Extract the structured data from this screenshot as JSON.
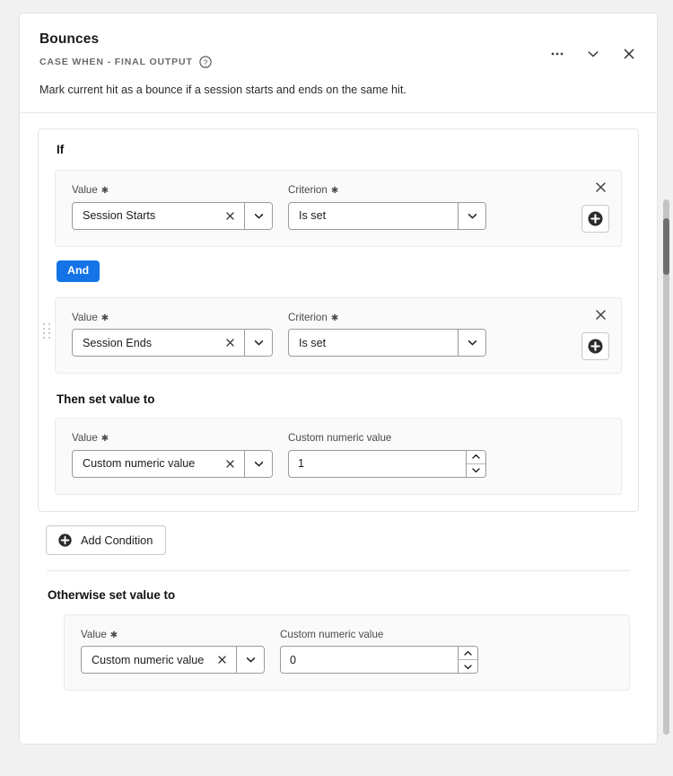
{
  "card": {
    "title": "Bounces",
    "subtitle": "CASE WHEN - FINAL OUTPUT",
    "help_icon": "help-circle-icon",
    "description": "Mark current hit as a bounce if a session starts and ends on the same hit.",
    "actions": {
      "more_icon": "ellipsis-icon",
      "collapse_icon": "chevron-down-icon",
      "close_icon": "close-icon"
    }
  },
  "if_group": {
    "heading": "If",
    "conditions": [
      {
        "value_label": "Value",
        "value_required": "✱",
        "value": "Session Starts",
        "clear_icon": "close-icon",
        "dropdown_icon": "chevron-down-icon",
        "criterion_label": "Criterion",
        "criterion_required": "✱",
        "criterion": "Is set",
        "criterion_dropdown_icon": "chevron-down-icon",
        "remove_icon": "close-icon",
        "add_icon": "plus-circle-icon"
      },
      {
        "value_label": "Value",
        "value_required": "✱",
        "value": "Session Ends",
        "clear_icon": "close-icon",
        "dropdown_icon": "chevron-down-icon",
        "criterion_label": "Criterion",
        "criterion_required": "✱",
        "criterion": "Is set",
        "criterion_dropdown_icon": "chevron-down-icon",
        "remove_icon": "close-icon",
        "add_icon": "plus-circle-icon",
        "drag_handle_icon": "drag-grip-icon"
      }
    ],
    "operator_badge": "And",
    "then": {
      "heading": "Then set value to",
      "value_label": "Value",
      "value_required": "✱",
      "value": "Custom numeric value",
      "clear_icon": "close-icon",
      "dropdown_icon": "chevron-down-icon",
      "numeric_label": "Custom numeric value",
      "numeric_value": "1",
      "step_up_icon": "chevron-up-icon",
      "step_down_icon": "chevron-down-icon"
    }
  },
  "add_condition": {
    "label": "Add Condition",
    "icon": "plus-circle-icon"
  },
  "otherwise": {
    "heading": "Otherwise set value to",
    "value_label": "Value",
    "value_required": "✱",
    "value": "Custom numeric value",
    "clear_icon": "close-icon",
    "dropdown_icon": "chevron-down-icon",
    "numeric_label": "Custom numeric value",
    "numeric_value": "0",
    "step_up_icon": "chevron-up-icon",
    "step_down_icon": "chevron-down-icon"
  },
  "scrollbar": {
    "name": "vertical-scrollbar"
  },
  "colors": {
    "accent_blue": "#1473e6",
    "page_background": "#f1f1f1",
    "card_background": "#ffffff",
    "panel_background": "#fafafa",
    "border": "#e3e3e3",
    "input_border": "#9a9a9a",
    "text_primary": "#1a1a1a",
    "text_secondary": "#6b6b6b",
    "scrollbar_thumb": "#6e6e6e"
  }
}
